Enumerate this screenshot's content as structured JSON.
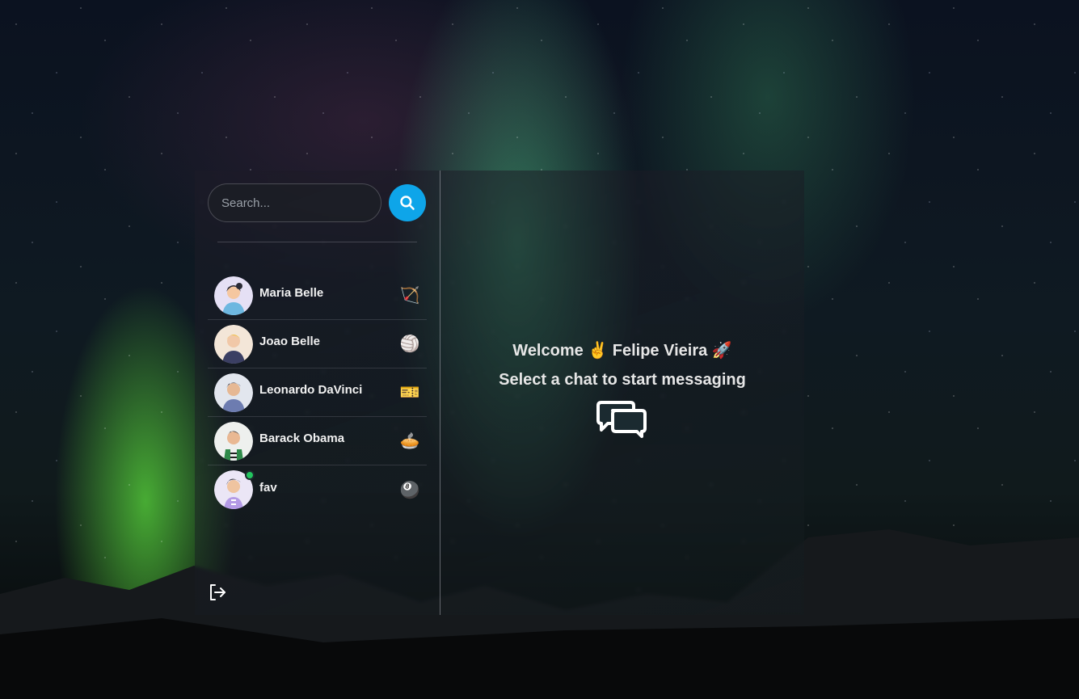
{
  "search": {
    "placeholder": "Search..."
  },
  "contacts": [
    {
      "name": "Maria Belle",
      "emoji": "🏹",
      "online": false
    },
    {
      "name": "Joao Belle",
      "emoji": "🏐",
      "online": false
    },
    {
      "name": "Leonardo DaVinci",
      "emoji": "🎫",
      "online": false
    },
    {
      "name": "Barack Obama",
      "emoji": "🥧",
      "online": false
    },
    {
      "name": "fav",
      "emoji": "🎱",
      "online": true
    }
  ],
  "welcome": {
    "greeting": "Welcome ✌️ Felipe Vieira 🚀",
    "subtitle": "Select a chat to start messaging"
  },
  "colors": {
    "accent": "#0ea5e9",
    "online": "#22c55e"
  },
  "icons": {
    "search": "search-icon",
    "logout": "logout-icon",
    "chat": "chat-bubbles-icon"
  }
}
